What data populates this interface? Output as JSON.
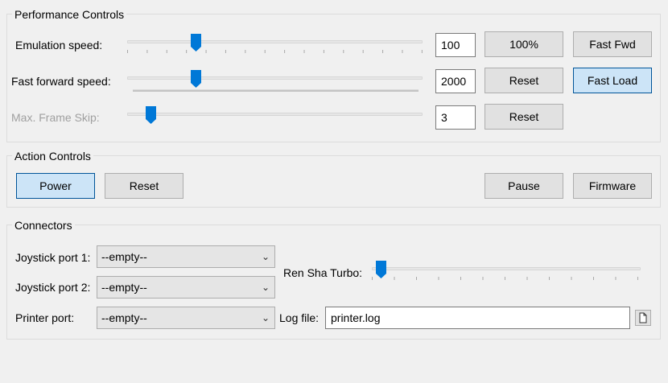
{
  "performance": {
    "title": "Performance Controls",
    "emulation_speed": {
      "label": "Emulation speed:",
      "value": "100",
      "level": 0.21,
      "btn1": "100%",
      "btn2": "Fast Fwd"
    },
    "fast_forward_speed": {
      "label": "Fast forward speed:",
      "value": "2000",
      "level": 0.21,
      "btn1": "Reset",
      "btn2": "Fast Load"
    },
    "max_frame_skip": {
      "label": "Max. Frame Skip:",
      "value": "3",
      "level": 0.05,
      "btn1": "Reset"
    }
  },
  "actions": {
    "title": "Action Controls",
    "power": "Power",
    "reset": "Reset",
    "pause": "Pause",
    "firmware": "Firmware"
  },
  "connectors": {
    "title": "Connectors",
    "joystick1": {
      "label": "Joystick port 1:",
      "value": "--empty--"
    },
    "joystick2": {
      "label": "Joystick port 2:",
      "value": "--empty--"
    },
    "printer": {
      "label": "Printer port:",
      "value": "--empty--"
    },
    "ren_sha": {
      "label": "Ren Sha Turbo:",
      "level": 0.0
    },
    "log_file": {
      "label": "Log file:",
      "value": "printer.log"
    }
  },
  "colors": {
    "accent": "#0078d7",
    "active_button": "#cce4f7"
  },
  "icons": {
    "dropdown": "chevron-down-icon",
    "browse": "document-icon",
    "slider_thumb": "slider-thumb-icon"
  }
}
